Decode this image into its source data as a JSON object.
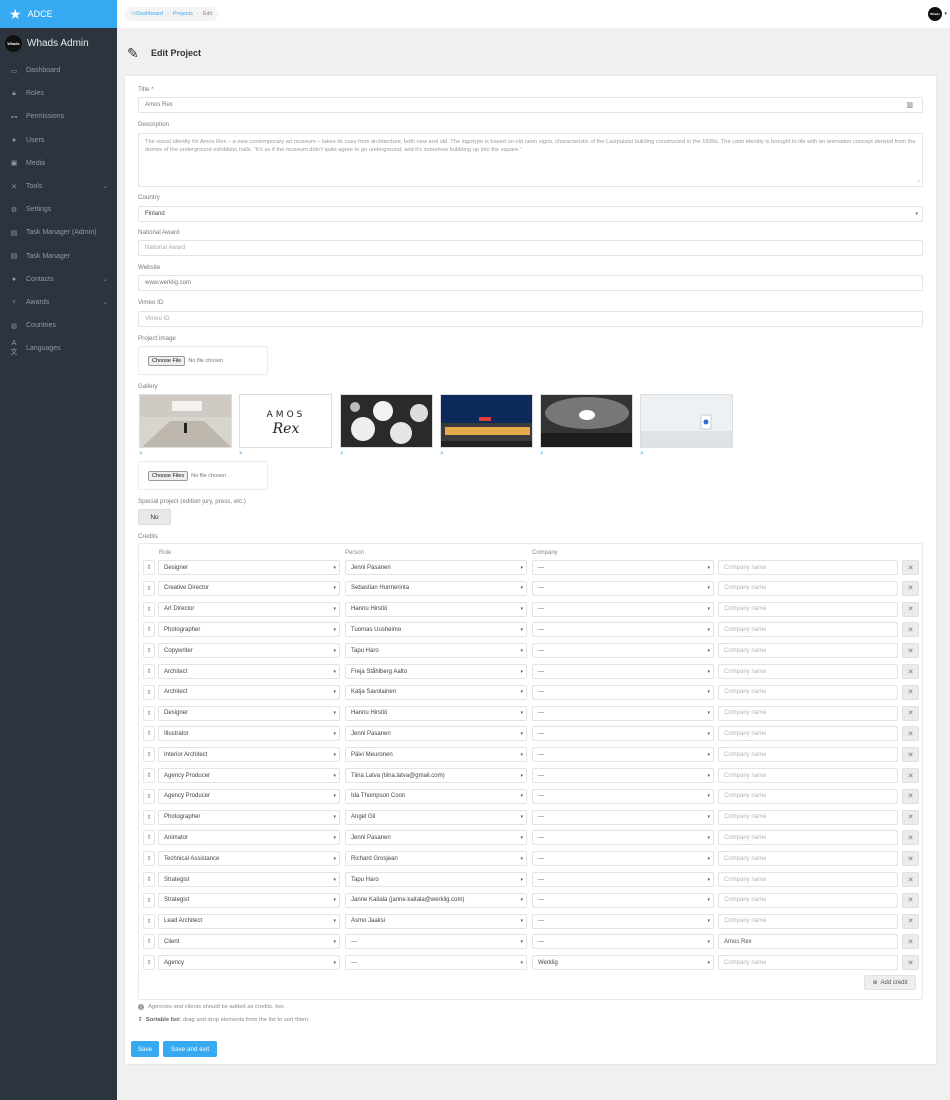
{
  "sidebar": {
    "brand": "ADCE",
    "user": {
      "avatar_text": "Whads",
      "name": "Whads Admin"
    },
    "items": [
      {
        "label": "Dashboard",
        "icon": "calendar-icon"
      },
      {
        "label": "Roles",
        "icon": "lock-icon"
      },
      {
        "label": "Permissions",
        "icon": "key-icon"
      },
      {
        "label": "Users",
        "icon": "user-icon"
      },
      {
        "label": "Media",
        "icon": "image-icon"
      },
      {
        "label": "Tools",
        "icon": "tools-icon",
        "has_children": true
      },
      {
        "label": "Settings",
        "icon": "gear-icon"
      },
      {
        "label": "Task Manager (Admin)",
        "icon": "clipboard-icon"
      },
      {
        "label": "Task Manager",
        "icon": "clipboard-icon"
      },
      {
        "label": "Contacts",
        "icon": "user-icon",
        "has_children": true
      },
      {
        "label": "Awards",
        "icon": "trophy-icon",
        "has_children": true
      },
      {
        "label": "Countries",
        "icon": "globe-icon"
      },
      {
        "label": "Languages",
        "icon": "language-icon"
      }
    ]
  },
  "breadcrumb": {
    "dashboard": "Dashboard",
    "projects": "Projects",
    "current": "Edit"
  },
  "topbar": {
    "avatar_text": "Whads"
  },
  "page": {
    "title": "Edit Project"
  },
  "form": {
    "title_label": "Title *",
    "title_value": "Amos Rex",
    "description_label": "Description",
    "description_value": "The visual identity for Amos Rex – a new contemporary art museum – takes its cues from architecture, both new and old. The logotype is based on old neon signs, characteristic of the Lasipalatsi building constructed in the 1930s. The calm identity is brought to life with an animation concept derived from the domes of the underground exhibition halls. “It’s as if the museum didn’t quite agree to go underground, and it’s somehow bubbling up into the square.”",
    "country_label": "Country",
    "country_value": "Finland",
    "national_award_label": "National Award",
    "national_award_placeholder": "National Award",
    "website_label": "Website",
    "website_value": "www.werklig.com",
    "vimeo_label": "Vimeo ID",
    "vimeo_placeholder": "Vimeo ID",
    "project_image_label": "Project image",
    "choose_file": "Choose File",
    "no_file": "No file chosen",
    "gallery_label": "Gallery",
    "choose_files": "Choose Files",
    "remove_symbol": "×",
    "gallery_logo_line1": "AMOS",
    "gallery_logo_line2": "Rex",
    "special_label": "Special project (edition jury, press, etc.)",
    "special_value": "No"
  },
  "credits": {
    "label": "Credits",
    "col_role": "Role",
    "col_person": "Person",
    "col_company": "Company",
    "company_placeholder": "Company name",
    "rows": [
      {
        "role": "Designer",
        "person": "Jenni Pasanen",
        "company": "---",
        "company_name": ""
      },
      {
        "role": "Creative Director",
        "person": "Sebastian Hurmerinta",
        "company": "---",
        "company_name": ""
      },
      {
        "role": "Art Director",
        "person": "Hannu Hirstiö",
        "company": "---",
        "company_name": ""
      },
      {
        "role": "Photographer",
        "person": "Tuomas Uusheimo",
        "company": "---",
        "company_name": ""
      },
      {
        "role": "Copywriter",
        "person": "Tapu Haro",
        "company": "---",
        "company_name": ""
      },
      {
        "role": "Architect",
        "person": "Freja Ståhlberg Aalto",
        "company": "---",
        "company_name": ""
      },
      {
        "role": "Architect",
        "person": "Katja Savolainen",
        "company": "---",
        "company_name": ""
      },
      {
        "role": "Designer",
        "person": "Hannu Hirstiö",
        "company": "---",
        "company_name": ""
      },
      {
        "role": "Illustrator",
        "person": "Jenni Pasanen",
        "company": "---",
        "company_name": ""
      },
      {
        "role": "Interior Architect",
        "person": "Päivi Meuronen",
        "company": "---",
        "company_name": ""
      },
      {
        "role": "Agency Producer",
        "person": "Tiina Latva (tiina.latva@gmail.com)",
        "company": "---",
        "company_name": ""
      },
      {
        "role": "Agency Producer",
        "person": "Ida Thompson Coon",
        "company": "---",
        "company_name": ""
      },
      {
        "role": "Photographer",
        "person": "Angel Gil",
        "company": "---",
        "company_name": ""
      },
      {
        "role": "Animator",
        "person": "Jenni Pasanen",
        "company": "---",
        "company_name": ""
      },
      {
        "role": "Technical Assistance",
        "person": "Richard Grosjean",
        "company": "---",
        "company_name": ""
      },
      {
        "role": "Strategist",
        "person": "Tapu Haro",
        "company": "---",
        "company_name": ""
      },
      {
        "role": "Strategist",
        "person": "Janne Kaitala (janne.kaitala@werklig.com)",
        "company": "---",
        "company_name": ""
      },
      {
        "role": "Lead Architect",
        "person": "Asmo Jaaksi",
        "company": "---",
        "company_name": ""
      },
      {
        "role": "Client",
        "person": "---",
        "company": "---",
        "company_name": "Amos Rex"
      },
      {
        "role": "Agency",
        "person": "---",
        "company": "Werklig",
        "company_name": ""
      }
    ],
    "add_label": "Add credit"
  },
  "hints": {
    "agencies": "Agencies and clients should be added as credits, too.",
    "sortable_bold": "Sortable list:",
    "sortable_text": "drag and drop elements from the list to sort them."
  },
  "buttons": {
    "save": "Save",
    "save_exit": "Save and exit"
  },
  "colors": {
    "accent": "#36a9f1",
    "sidebar": "#2c353e"
  }
}
